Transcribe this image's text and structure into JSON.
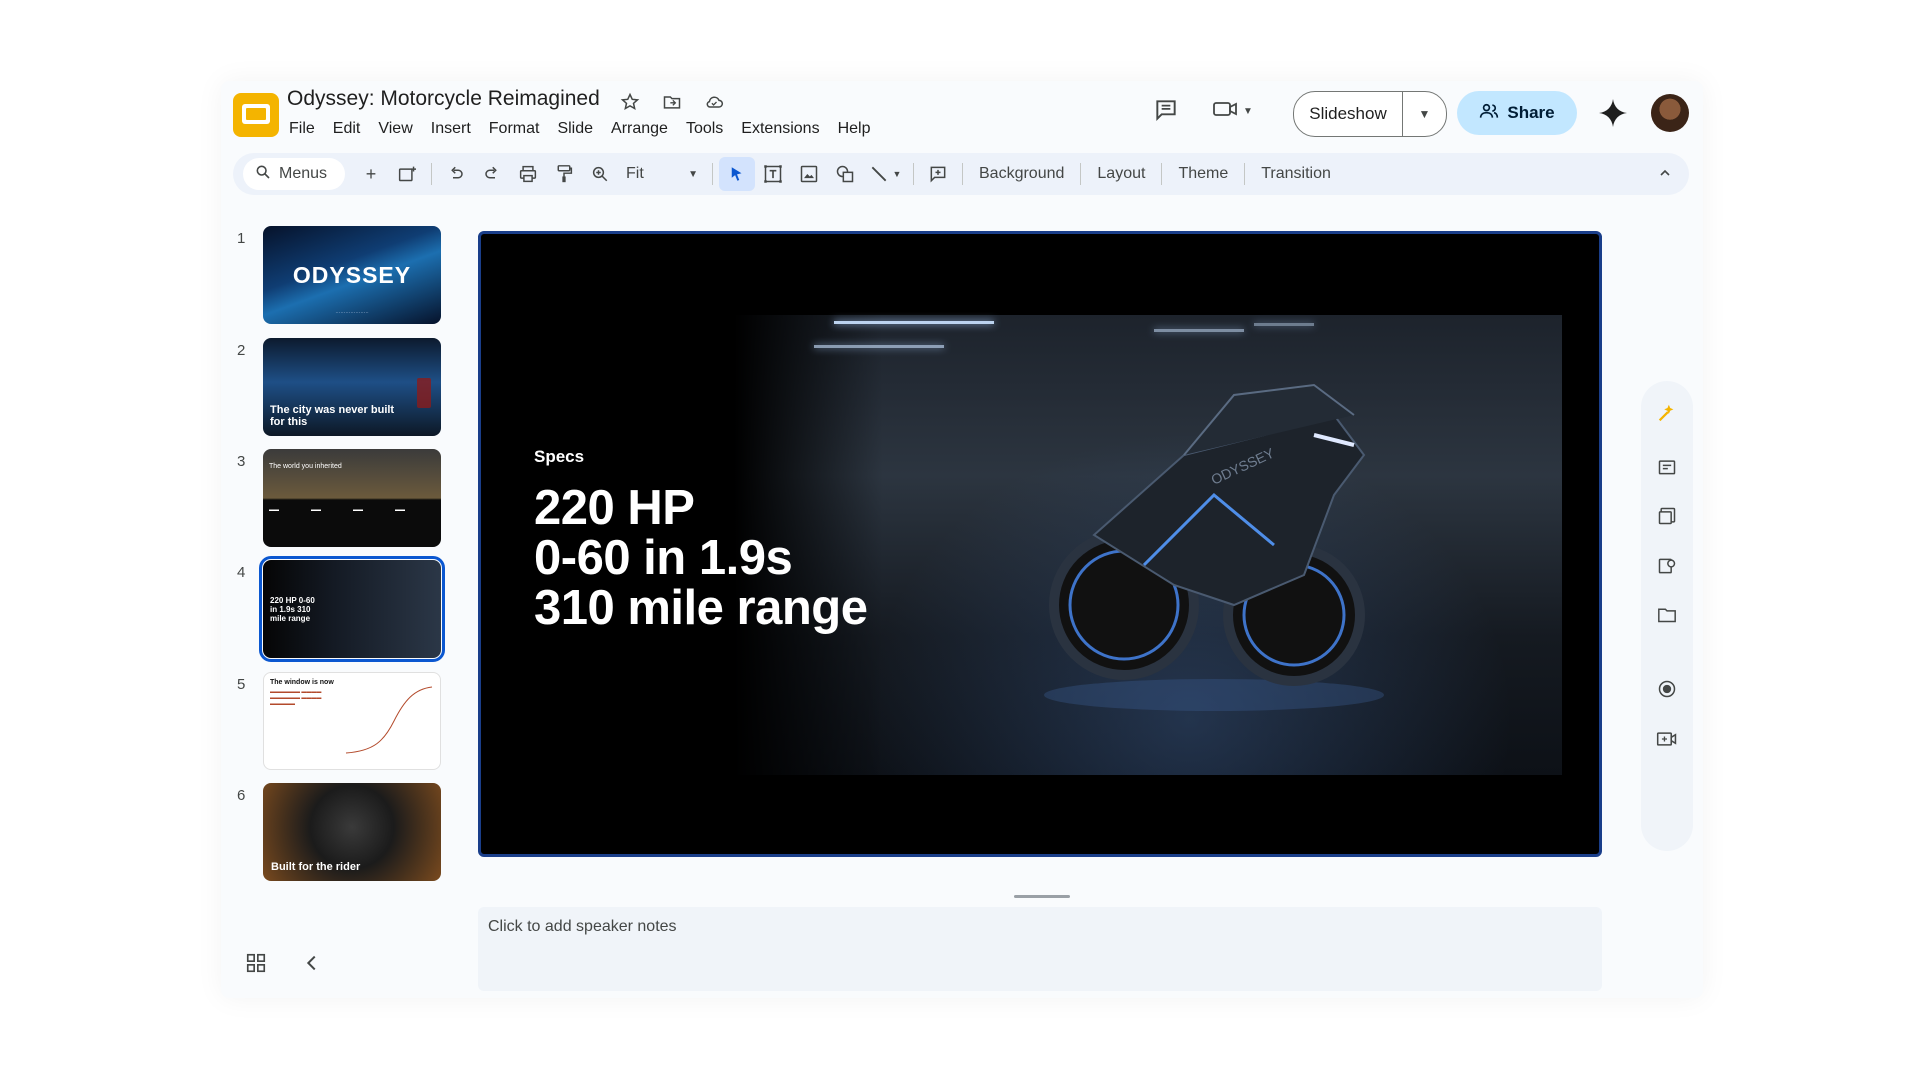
{
  "app": {
    "doc_title": "Odyssey: Motorcycle Reimagined",
    "title_icons": [
      "star-icon",
      "move-to-folder-icon",
      "cloud-saved-icon"
    ],
    "menu": [
      "File",
      "Edit",
      "View",
      "Insert",
      "Format",
      "Slide",
      "Arrange",
      "Tools",
      "Extensions",
      "Help"
    ]
  },
  "header": {
    "slideshow_label": "Slideshow",
    "share_label": "Share"
  },
  "toolbar": {
    "search_label": "Menus",
    "zoom_label": "Fit",
    "background_label": "Background",
    "layout_label": "Layout",
    "theme_label": "Theme",
    "transition_label": "Transition"
  },
  "filmstrip": {
    "slides": [
      {
        "num": "1",
        "title": "ODYSSEY"
      },
      {
        "num": "2",
        "title": "The city was never built for this"
      },
      {
        "num": "3",
        "title": "The world you inherited"
      },
      {
        "num": "4",
        "title": "220 HP 0-60 in 1.9s 310 mile range"
      },
      {
        "num": "5",
        "title": "The window is now"
      },
      {
        "num": "6",
        "title": "Built for the rider"
      }
    ],
    "selected_index": 4
  },
  "slide": {
    "label": "Specs",
    "lines": [
      "220 HP",
      "0-60 in 1.9s",
      "310 mile range"
    ]
  },
  "notes": {
    "placeholder": "Click to add speaker notes"
  },
  "colors": {
    "accent": "#0b57d0",
    "share_bg": "#c2e7ff",
    "logo": "#f4b400"
  }
}
